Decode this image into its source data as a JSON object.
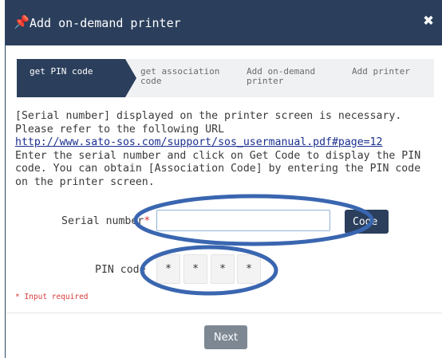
{
  "dialog": {
    "title": "Add on-demand printer",
    "pin_icon": "pushpin-icon",
    "close_symbol": "✖",
    "close_icon": "close-icon"
  },
  "steps": [
    {
      "line1": "get PIN code",
      "line2": ""
    },
    {
      "line1": "get association",
      "line2": "code"
    },
    {
      "line1": "Add on-demand",
      "line2": "printer"
    },
    {
      "line1": "Add printer",
      "line2": ""
    }
  ],
  "description": {
    "text1": "[Serial number] displayed on the printer screen is necessary. Please refer to the following URL",
    "link": "http://www.sato-sos.com/support/sos_usermanual.pdf#page=12",
    "text2": "Enter the serial number and click on Get Code to display the PIN code. You can obtain [Association Code] by entering the PIN code on the printer screen."
  },
  "form": {
    "serial_label": "Serial number",
    "required_mark": "*",
    "serial_value": "",
    "code_button": "Code",
    "pin_label": "PIN code",
    "pin_chars": [
      "*",
      "*",
      "*",
      "*"
    ],
    "required_note": "* Input required"
  },
  "footer": {
    "next_button": "Next"
  },
  "colors": {
    "header_bg": "#2b3f5c",
    "active_step": "#2b3f5c",
    "inactive_step": "#f0f1f2",
    "annotation_ellipse": "#3a66b0",
    "required": "#d83a3a",
    "next_button": "#7d8893"
  }
}
